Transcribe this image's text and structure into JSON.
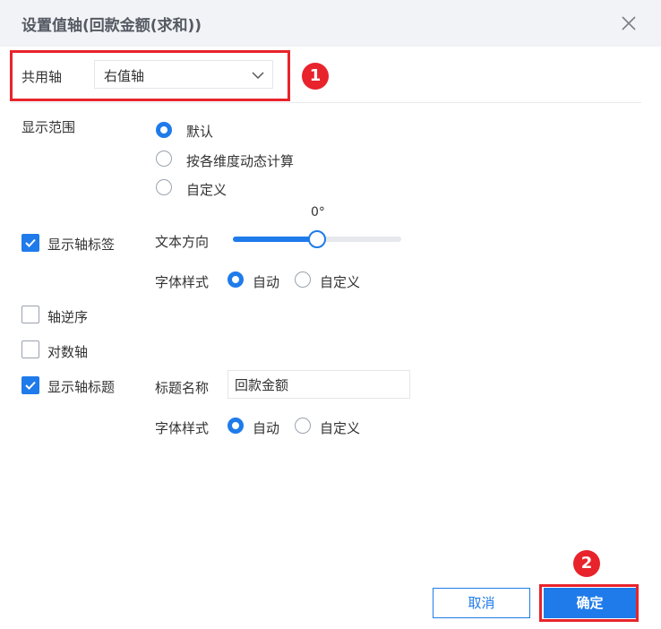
{
  "dialog": {
    "title": "设置值轴(回款金额(求和))",
    "close_icon": "close-icon"
  },
  "shared_axis": {
    "label": "共用轴",
    "selected": "右值轴"
  },
  "display_range": {
    "label": "显示范围",
    "options": [
      {
        "label": "默认",
        "selected": true
      },
      {
        "label": "按各维度动态计算",
        "selected": false
      },
      {
        "label": "自定义",
        "selected": false
      }
    ]
  },
  "axis_labels": {
    "label": "显示轴标签",
    "checked": true,
    "text_direction": {
      "label": "文本方向",
      "value": "0°",
      "level_fraction": 0.5
    },
    "font_style": {
      "label": "字体样式",
      "options": [
        {
          "label": "自动",
          "selected": true
        },
        {
          "label": "自定义",
          "selected": false
        }
      ]
    }
  },
  "axis_reverse": {
    "label": "轴逆序",
    "checked": false
  },
  "log_axis": {
    "label": "对数轴",
    "checked": false
  },
  "axis_title": {
    "label": "显示轴标题",
    "checked": true,
    "title_name": {
      "label": "标题名称",
      "value": "回款金额"
    },
    "font_style": {
      "label": "字体样式",
      "options": [
        {
          "label": "自动",
          "selected": true
        },
        {
          "label": "自定义",
          "selected": false
        }
      ]
    }
  },
  "footer": {
    "cancel_label": "取消",
    "ok_label": "确定"
  },
  "annotations": {
    "marker_1": "1",
    "marker_2": "2"
  },
  "colors": {
    "accent": "#1f7bea",
    "highlight": "#e8232b"
  }
}
